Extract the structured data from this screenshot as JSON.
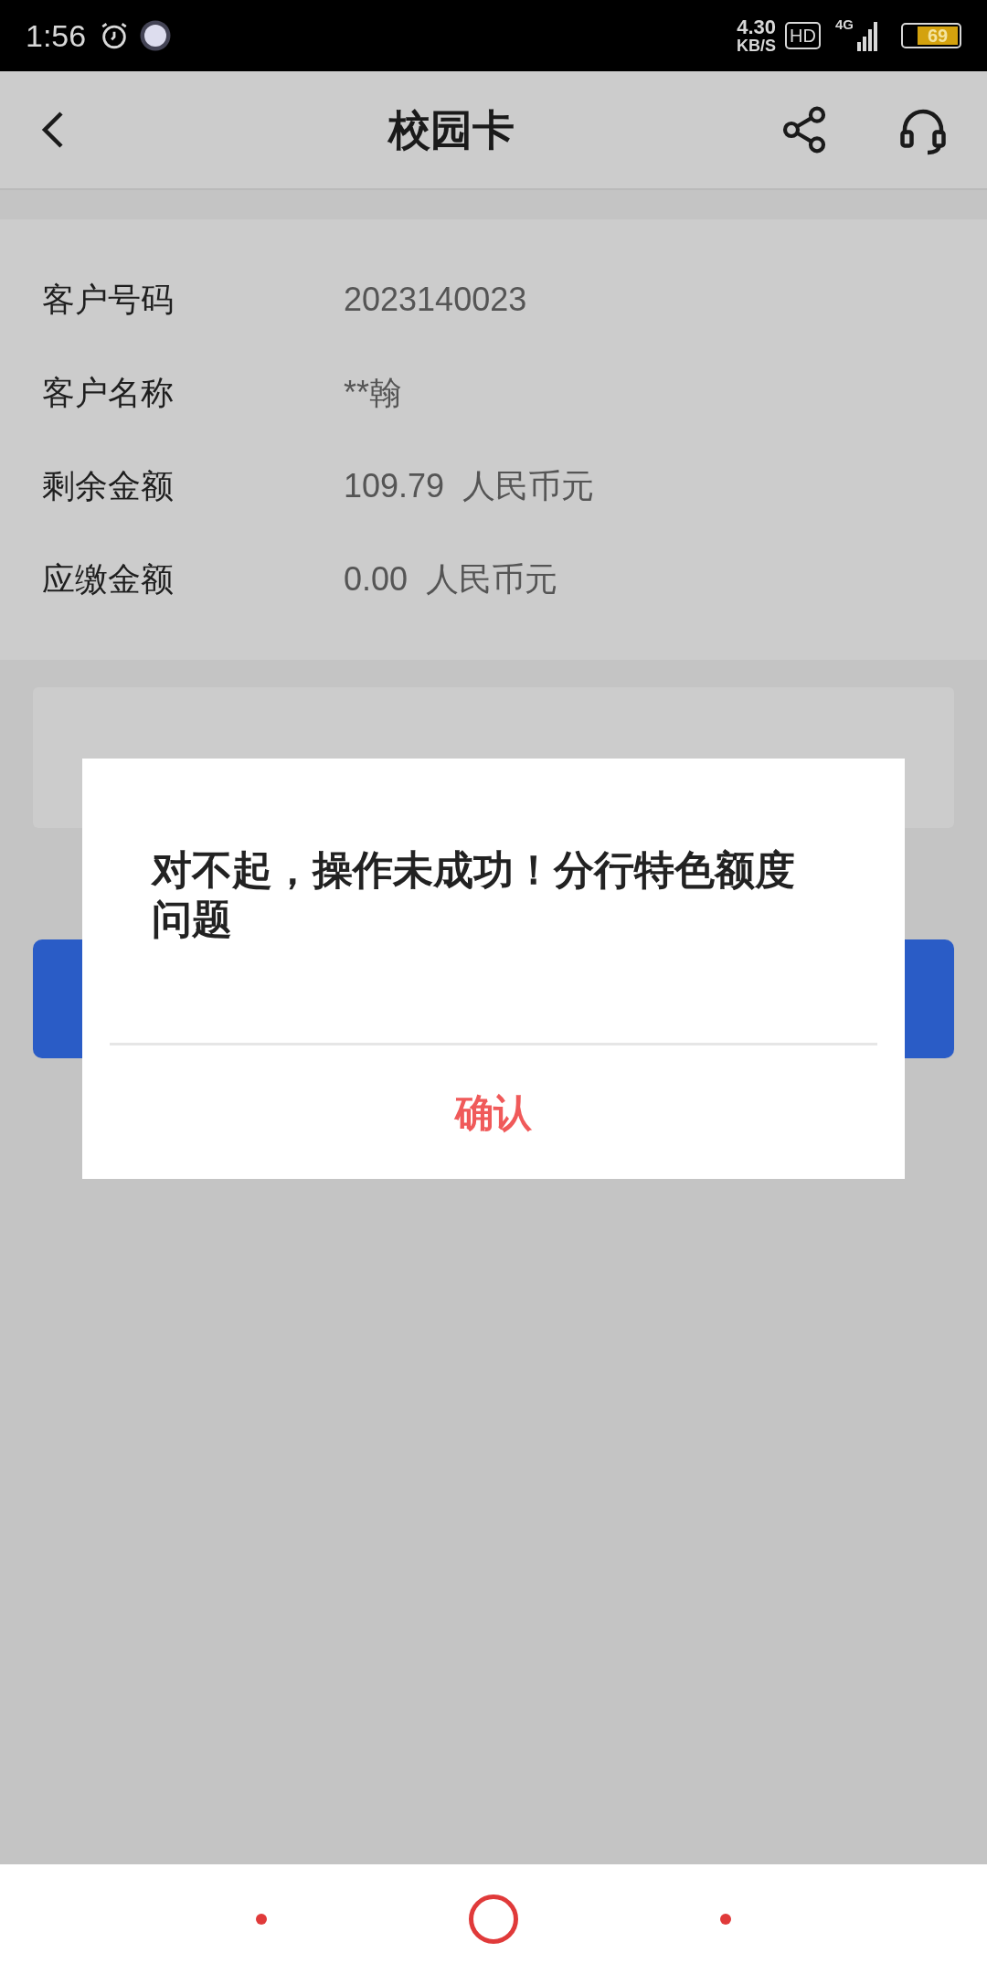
{
  "status_bar": {
    "time": "1:56",
    "speed_value": "4.30",
    "speed_unit": "KB/S",
    "hd": "HD",
    "network": "4G",
    "battery": "69"
  },
  "header": {
    "title": "校园卡"
  },
  "info": [
    {
      "label": "客户号码",
      "value": "2023140023"
    },
    {
      "label": "客户名称",
      "value": "**翰"
    },
    {
      "label": "剩余金额",
      "value": "109.79  人民币元"
    },
    {
      "label": "应缴金额",
      "value": "0.00  人民币元"
    }
  ],
  "dialog": {
    "message": "对不起，操作未成功！分行特色额度问题",
    "confirm": "确认"
  }
}
